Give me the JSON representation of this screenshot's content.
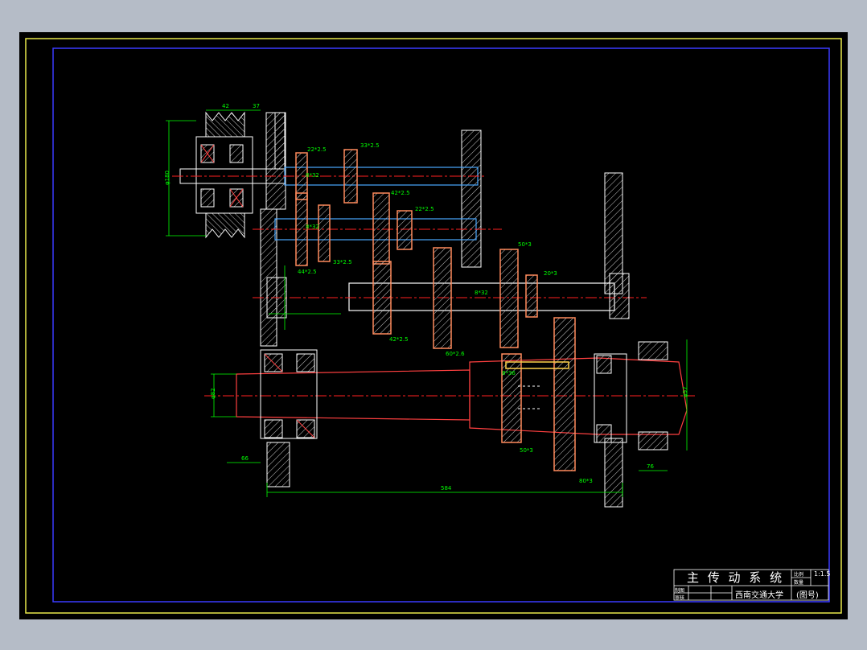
{
  "title_block": {
    "drawing_title": "主 传 动 系 统",
    "school": "西南交通大学",
    "drawing_number": "(图号)",
    "scale": "1:1.5",
    "small_labels": [
      "比例",
      "数量",
      "制图",
      "审核"
    ]
  },
  "dimensions": {
    "pulley_width": "42",
    "pulley_offset": "37",
    "pulley_dia": "φ180",
    "shaft_total_length": "584",
    "left_offset": "66",
    "right_offset": "76",
    "spindle_front_dia": "φ97",
    "spindle_rear_dia": "φ82"
  },
  "gear_labels": {
    "g1": "22*2.5",
    "g2": "33*2.5",
    "g3": "42*2.5",
    "g4": "22*2.5",
    "g5": "33*2.5",
    "g6": "44*2.5",
    "g7": "50*3",
    "g8": "20*3",
    "g9": "42*2.5",
    "g10": "60*2.6",
    "g11": "50*3",
    "g12": "80*3"
  },
  "spline_labels": {
    "s1": "8*32",
    "s2": "8*32",
    "s3": "8*32",
    "s4": "8*36"
  },
  "colors": {
    "border_yellow": "#e8e84a",
    "frame_blue": "#3b3bff",
    "outline_white": "#ffffff",
    "centerline_red": "#ff2020",
    "dimension_green": "#00ff00",
    "gear_orange": "#ff8a5c",
    "shaft_blue": "#4aa8ff",
    "spindle_red": "#ff4040",
    "hatch_gray": "#c8c8c8"
  }
}
